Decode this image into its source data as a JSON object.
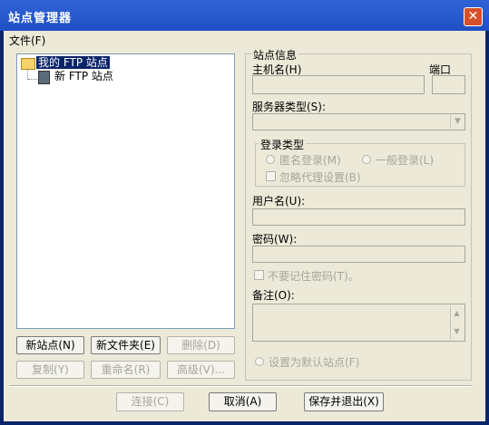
{
  "window": {
    "title": "站点管理器",
    "close": "✕"
  },
  "menu": {
    "file": "文件(F)"
  },
  "tree": {
    "root": "我的 FTP 站点",
    "child": "新 FTP 站点"
  },
  "left_buttons": {
    "new_site": "新站点(N)",
    "new_folder": "新文件夹(E)",
    "delete": "删除(D)",
    "copy": "复制(Y)",
    "rename": "重命名(R)",
    "advanced": "高级(V)..."
  },
  "site_info": {
    "group_label": "站点信息",
    "host_label": "主机名(H)",
    "port_label": "端口",
    "server_type_label": "服务器类型(S):",
    "login_type_label": "登录类型",
    "anonymous_login": "匿名登录(M)",
    "normal_login": "一般登录(L)",
    "ignore_proxy": "忽略代理设置(B)",
    "username_label": "用户名(U):",
    "password_label": "密码(W):",
    "no_remember_password": "不要记住密码(T)。",
    "notes_label": "备注(O):",
    "set_default": "设置为默认站点(F)"
  },
  "bottom_buttons": {
    "connect": "连接(C)",
    "cancel": "取消(A)",
    "save_exit": "保存并退出(X)"
  }
}
